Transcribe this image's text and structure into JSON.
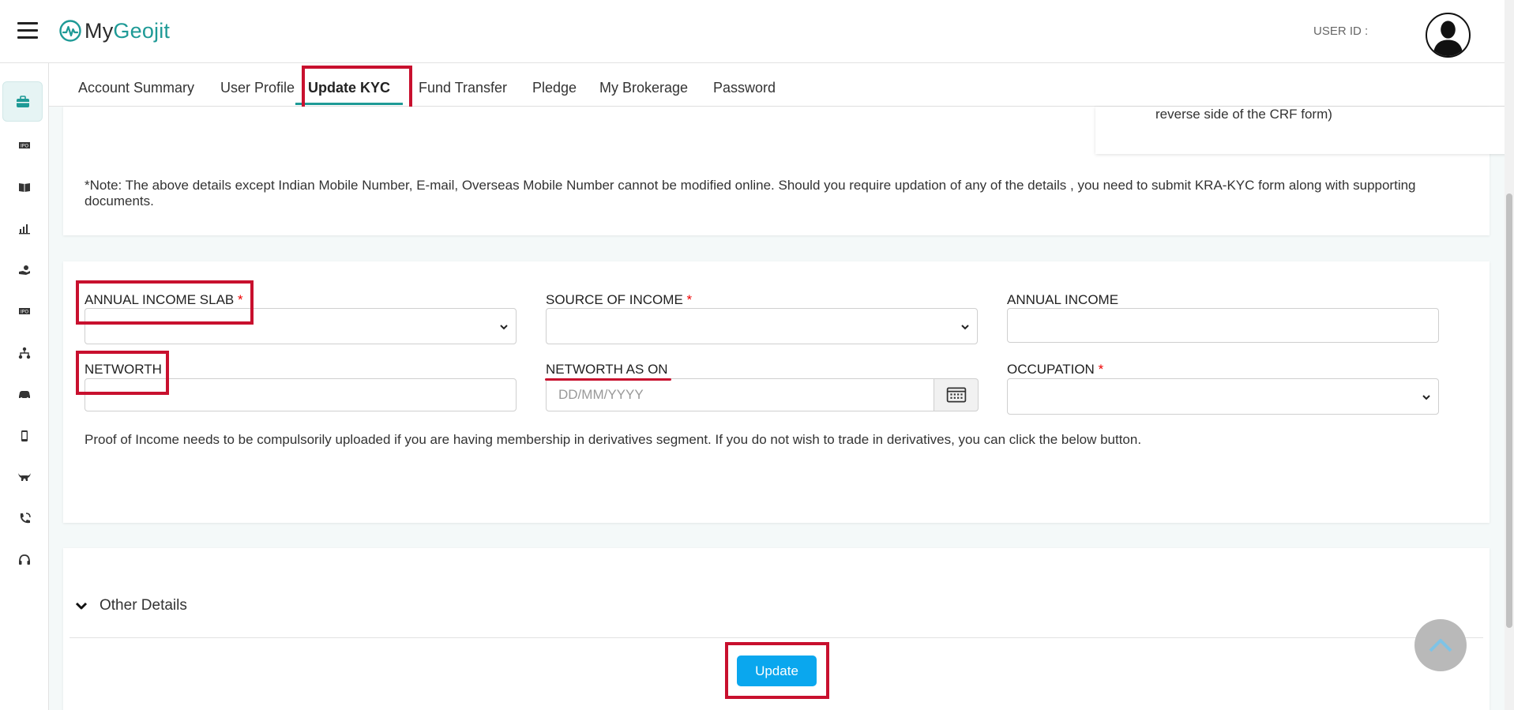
{
  "app": {
    "logo_my": "My",
    "logo_geo": "Geojit",
    "user_id_label": "USER ID :"
  },
  "rail_icons": [
    "briefcase-icon",
    "ipo-icon",
    "book-icon",
    "bar-chart-icon",
    "hand-coin-icon",
    "ipo-icon",
    "hierarchy-icon",
    "car-icon",
    "mobile-icon",
    "bull-icon",
    "phone-icon",
    "headset-icon"
  ],
  "tabs": [
    {
      "label": "Account Summary"
    },
    {
      "label": "User Profile"
    },
    {
      "label": "Update KYC",
      "active": true
    },
    {
      "label": "Fund Transfer"
    },
    {
      "label": "Pledge"
    },
    {
      "label": "My Brokerage"
    },
    {
      "label": "Password"
    }
  ],
  "top_card": {
    "inner_tail": "reverse side of the CRF form)",
    "note": "*Note: The above details except Indian Mobile Number, E-mail, Overseas Mobile Number cannot be modified online. Should you require updation of any of the details , you need to submit KRA-KYC form along with supporting documents."
  },
  "form": {
    "annual_income_slab": {
      "label": "ANNUAL INCOME SLAB",
      "required": "*",
      "value": ""
    },
    "source_of_income": {
      "label": "SOURCE OF INCOME",
      "required": "*",
      "value": ""
    },
    "annual_income": {
      "label": "ANNUAL INCOME",
      "value": ""
    },
    "networth": {
      "label": "NETWORTH",
      "value": ""
    },
    "networth_as_on": {
      "label": "NETWORTH AS ON",
      "placeholder": "DD/MM/YYYY"
    },
    "occupation": {
      "label": "OCCUPATION",
      "required": "*",
      "value": ""
    },
    "proof_note": "Proof of Income needs to be compulsorily uploaded if you are having membership in derivatives segment. If you do not wish to trade in derivatives, you can click the below button."
  },
  "other_details": {
    "label": "Other Details",
    "update_label": "Update"
  },
  "colors": {
    "brand_teal": "#1e9a96",
    "update_blue": "#0aa7ee",
    "highlight_red": "#c8102e",
    "required_red": "#e00000"
  }
}
